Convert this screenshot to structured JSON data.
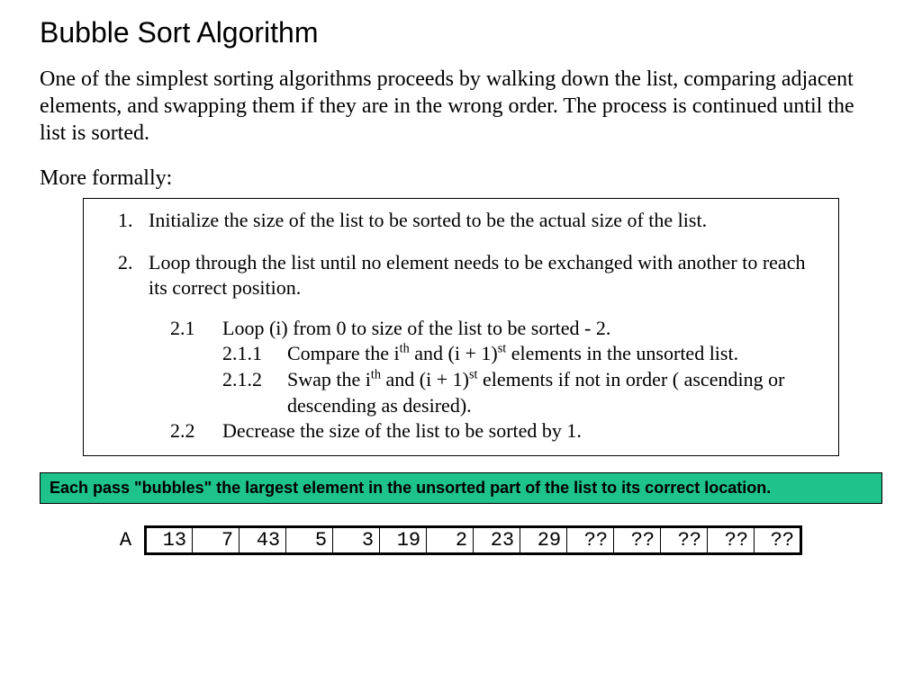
{
  "title": "Bubble Sort Algorithm",
  "intro": "One of the simplest sorting algorithms proceeds by walking down the list, comparing adjacent elements, and swapping them if they are in the wrong order.  The process is continued until the list is sorted.",
  "lead": "More formally:",
  "algo": {
    "item1": "Initialize the size of the list to be sorted to be the actual size of the list.",
    "item2": "Loop through the list until no element needs to be exchanged with another to reach its correct position.",
    "sub21_num": "2.1",
    "sub21_txt": "Loop (i) from 0 to size of the list to be sorted - 2.",
    "sub211_num": "2.1.1",
    "sub211_prefix": "Compare the i",
    "sub211_mid": " and (i + 1)",
    "sub211_suffix": " elements in the unsorted list.",
    "sub212_num": "2.1.2",
    "sub212_prefix": "Swap the i",
    "sub212_mid": " and (i + 1)",
    "sub212_suffix": " elements if not in order ( ascending or descending as desired).",
    "sub22_num": "2.2",
    "sub22_txt": "Decrease the size of the list to be sorted by 1.",
    "th": "th",
    "st": "st"
  },
  "callout": "Each pass \"bubbles\" the largest element in the unsorted part of the list to its correct location.",
  "array_label": "A",
  "array": [
    "13",
    "7",
    "43",
    "5",
    "3",
    "19",
    "2",
    "23",
    "29",
    "??",
    "??",
    "??",
    "??",
    "??"
  ]
}
